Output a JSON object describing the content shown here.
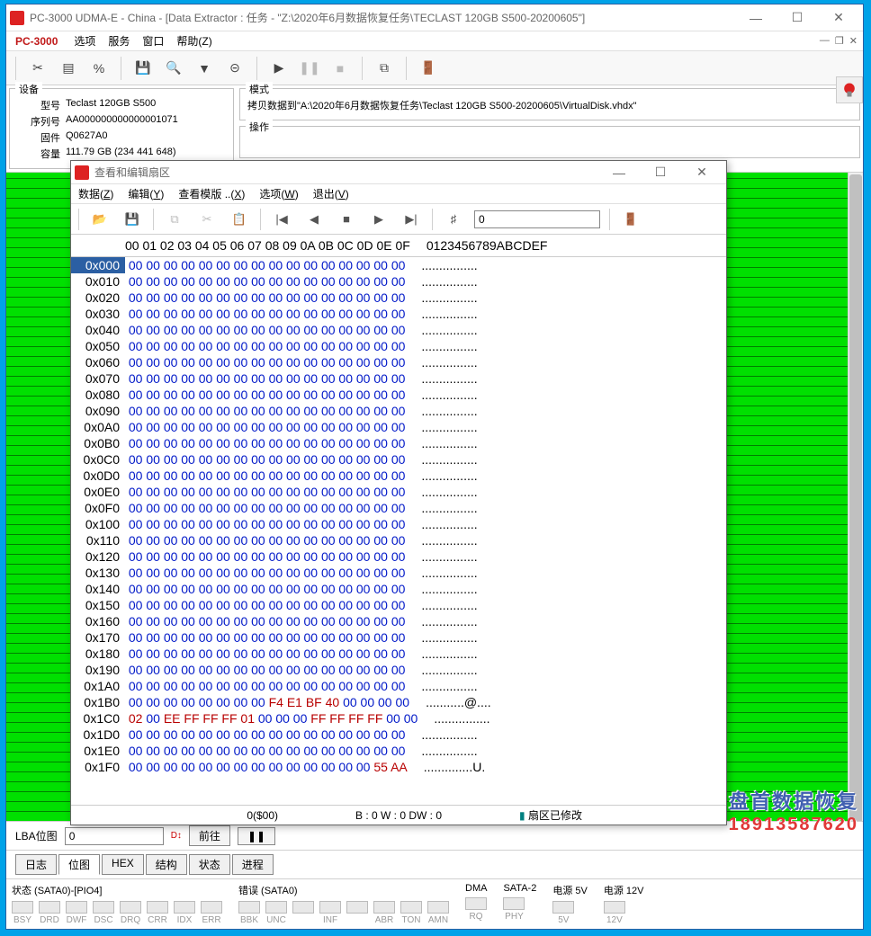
{
  "main": {
    "title": "PC-3000 UDMA-E - China - [Data Extractor : 任务 - \"Z:\\2020年6月数据恢复任务\\TECLAST 120GB S500-20200605\"]",
    "brand": "PC-3000",
    "menu": {
      "options": "选项",
      "service": "服务",
      "window": "窗口",
      "help": "帮助(Z)"
    },
    "device": {
      "legend": "设备",
      "model_lbl": "型号",
      "model": "Teclast 120GB S500",
      "serial_lbl": "序列号",
      "serial": "AA000000000000001071",
      "fw_lbl": "固件",
      "fw": "Q0627A0",
      "cap_lbl": "容量",
      "cap": "111.79 GB (234 441 648)"
    },
    "mode": {
      "legend": "模式",
      "text": "拷贝数据到\"A:\\2020年6月数据恢复任务\\Teclast 120GB S500-20200605\\VirtualDisk.vhdx\""
    },
    "op": {
      "legend": "操作"
    },
    "lba": {
      "label": "LBA位图",
      "value": "0",
      "go": "前往",
      "pause": "❚❚"
    },
    "tabs": {
      "log": "日志",
      "map": "位图",
      "hex": "HEX",
      "struct": "结构",
      "state": "状态",
      "proc": "进程"
    },
    "status": {
      "s0": "状态 (SATA0)-[PIO4]",
      "s0_leds": [
        "BSY",
        "DRD",
        "DWF",
        "DSC",
        "DRQ",
        "CRR",
        "IDX",
        "ERR"
      ],
      "err": "错误 (SATA0)",
      "err_leds": [
        "BBK",
        "UNC",
        "",
        "INF",
        "",
        "ABR",
        "TON",
        "AMN"
      ],
      "dma": "DMA",
      "dma_leds": [
        "RQ"
      ],
      "sata": "SATA-2",
      "sata_leds": [
        "PHY"
      ],
      "p5": "电源 5V",
      "p5_leds": [
        "5V"
      ],
      "p12": "电源 12V",
      "p12_leds": [
        "12V"
      ]
    }
  },
  "hex": {
    "title": "查看和编辑扇区",
    "menu": {
      "data": "数据(Z)",
      "edit": "编辑(Y)",
      "tpl": "查看模版 ..(X)",
      "opt": "选项(W)",
      "exit": "退出(V)"
    },
    "goto": "0",
    "header_off": "  ",
    "header_cols": "00 01 02 03 04 05 06 07 08 09 0A 0B 0C 0D 0E 0F",
    "header_ascii": "0123456789ABCDEF",
    "status_off": "0($00)",
    "status_mid": "B : 0 W : 0 DW : 0",
    "status_mod": "扇区已修改",
    "rows": [
      {
        "off": "0x000",
        "b": [
          "00",
          "00",
          "00",
          "00",
          "00",
          "00",
          "00",
          "00",
          "00",
          "00",
          "00",
          "00",
          "00",
          "00",
          "00",
          "00"
        ],
        "a": "................",
        "sel": true
      },
      {
        "off": "0x010",
        "b": [
          "00",
          "00",
          "00",
          "00",
          "00",
          "00",
          "00",
          "00",
          "00",
          "00",
          "00",
          "00",
          "00",
          "00",
          "00",
          "00"
        ],
        "a": "................"
      },
      {
        "off": "0x020",
        "b": [
          "00",
          "00",
          "00",
          "00",
          "00",
          "00",
          "00",
          "00",
          "00",
          "00",
          "00",
          "00",
          "00",
          "00",
          "00",
          "00"
        ],
        "a": "................"
      },
      {
        "off": "0x030",
        "b": [
          "00",
          "00",
          "00",
          "00",
          "00",
          "00",
          "00",
          "00",
          "00",
          "00",
          "00",
          "00",
          "00",
          "00",
          "00",
          "00"
        ],
        "a": "................"
      },
      {
        "off": "0x040",
        "b": [
          "00",
          "00",
          "00",
          "00",
          "00",
          "00",
          "00",
          "00",
          "00",
          "00",
          "00",
          "00",
          "00",
          "00",
          "00",
          "00"
        ],
        "a": "................"
      },
      {
        "off": "0x050",
        "b": [
          "00",
          "00",
          "00",
          "00",
          "00",
          "00",
          "00",
          "00",
          "00",
          "00",
          "00",
          "00",
          "00",
          "00",
          "00",
          "00"
        ],
        "a": "................"
      },
      {
        "off": "0x060",
        "b": [
          "00",
          "00",
          "00",
          "00",
          "00",
          "00",
          "00",
          "00",
          "00",
          "00",
          "00",
          "00",
          "00",
          "00",
          "00",
          "00"
        ],
        "a": "................"
      },
      {
        "off": "0x070",
        "b": [
          "00",
          "00",
          "00",
          "00",
          "00",
          "00",
          "00",
          "00",
          "00",
          "00",
          "00",
          "00",
          "00",
          "00",
          "00",
          "00"
        ],
        "a": "................"
      },
      {
        "off": "0x080",
        "b": [
          "00",
          "00",
          "00",
          "00",
          "00",
          "00",
          "00",
          "00",
          "00",
          "00",
          "00",
          "00",
          "00",
          "00",
          "00",
          "00"
        ],
        "a": "................"
      },
      {
        "off": "0x090",
        "b": [
          "00",
          "00",
          "00",
          "00",
          "00",
          "00",
          "00",
          "00",
          "00",
          "00",
          "00",
          "00",
          "00",
          "00",
          "00",
          "00"
        ],
        "a": "................"
      },
      {
        "off": "0x0A0",
        "b": [
          "00",
          "00",
          "00",
          "00",
          "00",
          "00",
          "00",
          "00",
          "00",
          "00",
          "00",
          "00",
          "00",
          "00",
          "00",
          "00"
        ],
        "a": "................"
      },
      {
        "off": "0x0B0",
        "b": [
          "00",
          "00",
          "00",
          "00",
          "00",
          "00",
          "00",
          "00",
          "00",
          "00",
          "00",
          "00",
          "00",
          "00",
          "00",
          "00"
        ],
        "a": "................"
      },
      {
        "off": "0x0C0",
        "b": [
          "00",
          "00",
          "00",
          "00",
          "00",
          "00",
          "00",
          "00",
          "00",
          "00",
          "00",
          "00",
          "00",
          "00",
          "00",
          "00"
        ],
        "a": "................"
      },
      {
        "off": "0x0D0",
        "b": [
          "00",
          "00",
          "00",
          "00",
          "00",
          "00",
          "00",
          "00",
          "00",
          "00",
          "00",
          "00",
          "00",
          "00",
          "00",
          "00"
        ],
        "a": "................"
      },
      {
        "off": "0x0E0",
        "b": [
          "00",
          "00",
          "00",
          "00",
          "00",
          "00",
          "00",
          "00",
          "00",
          "00",
          "00",
          "00",
          "00",
          "00",
          "00",
          "00"
        ],
        "a": "................"
      },
      {
        "off": "0x0F0",
        "b": [
          "00",
          "00",
          "00",
          "00",
          "00",
          "00",
          "00",
          "00",
          "00",
          "00",
          "00",
          "00",
          "00",
          "00",
          "00",
          "00"
        ],
        "a": "................"
      },
      {
        "off": "0x100",
        "b": [
          "00",
          "00",
          "00",
          "00",
          "00",
          "00",
          "00",
          "00",
          "00",
          "00",
          "00",
          "00",
          "00",
          "00",
          "00",
          "00"
        ],
        "a": "................"
      },
      {
        "off": "0x110",
        "b": [
          "00",
          "00",
          "00",
          "00",
          "00",
          "00",
          "00",
          "00",
          "00",
          "00",
          "00",
          "00",
          "00",
          "00",
          "00",
          "00"
        ],
        "a": "................"
      },
      {
        "off": "0x120",
        "b": [
          "00",
          "00",
          "00",
          "00",
          "00",
          "00",
          "00",
          "00",
          "00",
          "00",
          "00",
          "00",
          "00",
          "00",
          "00",
          "00"
        ],
        "a": "................"
      },
      {
        "off": "0x130",
        "b": [
          "00",
          "00",
          "00",
          "00",
          "00",
          "00",
          "00",
          "00",
          "00",
          "00",
          "00",
          "00",
          "00",
          "00",
          "00",
          "00"
        ],
        "a": "................"
      },
      {
        "off": "0x140",
        "b": [
          "00",
          "00",
          "00",
          "00",
          "00",
          "00",
          "00",
          "00",
          "00",
          "00",
          "00",
          "00",
          "00",
          "00",
          "00",
          "00"
        ],
        "a": "................"
      },
      {
        "off": "0x150",
        "b": [
          "00",
          "00",
          "00",
          "00",
          "00",
          "00",
          "00",
          "00",
          "00",
          "00",
          "00",
          "00",
          "00",
          "00",
          "00",
          "00"
        ],
        "a": "................"
      },
      {
        "off": "0x160",
        "b": [
          "00",
          "00",
          "00",
          "00",
          "00",
          "00",
          "00",
          "00",
          "00",
          "00",
          "00",
          "00",
          "00",
          "00",
          "00",
          "00"
        ],
        "a": "................"
      },
      {
        "off": "0x170",
        "b": [
          "00",
          "00",
          "00",
          "00",
          "00",
          "00",
          "00",
          "00",
          "00",
          "00",
          "00",
          "00",
          "00",
          "00",
          "00",
          "00"
        ],
        "a": "................"
      },
      {
        "off": "0x180",
        "b": [
          "00",
          "00",
          "00",
          "00",
          "00",
          "00",
          "00",
          "00",
          "00",
          "00",
          "00",
          "00",
          "00",
          "00",
          "00",
          "00"
        ],
        "a": "................"
      },
      {
        "off": "0x190",
        "b": [
          "00",
          "00",
          "00",
          "00",
          "00",
          "00",
          "00",
          "00",
          "00",
          "00",
          "00",
          "00",
          "00",
          "00",
          "00",
          "00"
        ],
        "a": "................"
      },
      {
        "off": "0x1A0",
        "b": [
          "00",
          "00",
          "00",
          "00",
          "00",
          "00",
          "00",
          "00",
          "00",
          "00",
          "00",
          "00",
          "00",
          "00",
          "00",
          "00"
        ],
        "a": "................"
      },
      {
        "off": "0x1B0",
        "b": [
          "00",
          "00",
          "00",
          "00",
          "00",
          "00",
          "00",
          "00",
          "F4",
          "E1",
          "BF",
          "40",
          "00",
          "00",
          "00",
          "00"
        ],
        "a": "...........@....",
        "mod": [
          8,
          9,
          10,
          11
        ]
      },
      {
        "off": "0x1C0",
        "b": [
          "02",
          "00",
          "EE",
          "FF",
          "FF",
          "FF",
          "01",
          "00",
          "00",
          "00",
          "FF",
          "FF",
          "FF",
          "FF",
          "00",
          "00"
        ],
        "a": "................",
        "mod": [
          0,
          2,
          3,
          4,
          5,
          6,
          10,
          11,
          12,
          13
        ]
      },
      {
        "off": "0x1D0",
        "b": [
          "00",
          "00",
          "00",
          "00",
          "00",
          "00",
          "00",
          "00",
          "00",
          "00",
          "00",
          "00",
          "00",
          "00",
          "00",
          "00"
        ],
        "a": "................"
      },
      {
        "off": "0x1E0",
        "b": [
          "00",
          "00",
          "00",
          "00",
          "00",
          "00",
          "00",
          "00",
          "00",
          "00",
          "00",
          "00",
          "00",
          "00",
          "00",
          "00"
        ],
        "a": "................"
      },
      {
        "off": "0x1F0",
        "b": [
          "00",
          "00",
          "00",
          "00",
          "00",
          "00",
          "00",
          "00",
          "00",
          "00",
          "00",
          "00",
          "00",
          "00",
          "55",
          "AA"
        ],
        "a": "..............U.",
        "mod": [
          14,
          15
        ]
      }
    ]
  },
  "watermark": {
    "l1": "盘首数据恢复",
    "l2": "18913587620"
  }
}
